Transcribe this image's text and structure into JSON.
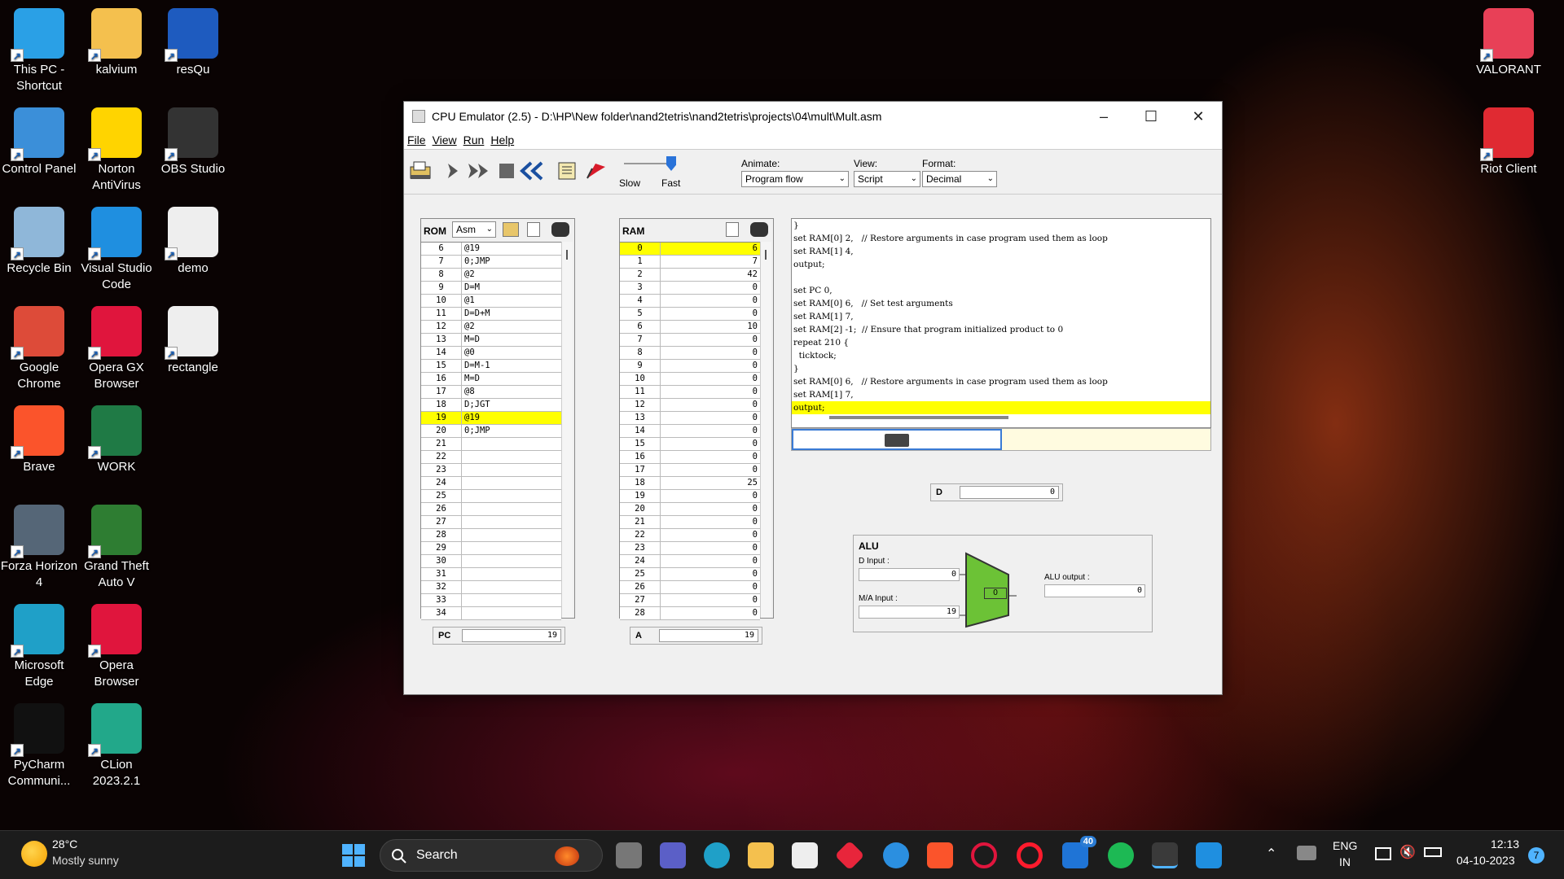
{
  "desktop_icons": [
    {
      "label": "This PC - Shortcut",
      "icon": "monitor-icon",
      "color": "#2aa0e6"
    },
    {
      "label": "kalvium",
      "icon": "folder-icon",
      "color": "#f4c04e"
    },
    {
      "label": "resQu",
      "icon": "word-doc-icon",
      "color": "#1e5bbf"
    },
    {
      "label": "Control Panel",
      "icon": "control-panel-icon",
      "color": "#3b8fd9"
    },
    {
      "label": "Norton AntiVirus",
      "icon": "norton-icon",
      "color": "#ffd400"
    },
    {
      "label": "OBS Studio",
      "icon": "obs-icon",
      "color": "#333333"
    },
    {
      "label": "Recycle Bin",
      "icon": "recycle-bin-icon",
      "color": "#8fb7d9"
    },
    {
      "label": "Visual Studio Code",
      "icon": "vscode-icon",
      "color": "#1f8fe0"
    },
    {
      "label": "demo",
      "icon": "file-icon",
      "color": "#eeeeee"
    },
    {
      "label": "Google Chrome",
      "icon": "chrome-icon",
      "color": "#dd4b39"
    },
    {
      "label": "Opera GX Browser",
      "icon": "opera-gx-icon",
      "color": "#e0153d"
    },
    {
      "label": "rectangle",
      "icon": "file-icon",
      "color": "#eeeeee"
    },
    {
      "label": "Brave",
      "icon": "brave-icon",
      "color": "#fb542b"
    },
    {
      "label": "WORK",
      "icon": "excel-icon",
      "color": "#1f7a45"
    },
    {
      "label": "Forza Horizon 4",
      "icon": "forza-icon",
      "color": "#556677"
    },
    {
      "label": "Grand Theft Auto V",
      "icon": "gta-icon",
      "color": "#2e7d32"
    },
    {
      "label": "Microsoft Edge",
      "icon": "edge-icon",
      "color": "#1fa0c8"
    },
    {
      "label": "Opera Browser",
      "icon": "opera-icon",
      "color": "#e0153d"
    },
    {
      "label": "PyCharm Communi...",
      "icon": "pycharm-icon",
      "color": "#111111"
    },
    {
      "label": "CLion 2023.2.1",
      "icon": "clion-icon",
      "color": "#22a88a"
    }
  ],
  "right_icons": [
    {
      "label": "VALORANT",
      "icon": "valorant-icon",
      "color": "#e84057"
    },
    {
      "label": "Riot Client",
      "icon": "riot-icon",
      "color": "#e02a32"
    }
  ],
  "window": {
    "title": "CPU Emulator (2.5) - D:\\HP\\New folder\\nand2tetris\\nand2tetris\\projects\\04\\mult\\Mult.asm",
    "menu": [
      "File",
      "View",
      "Run",
      "Help"
    ],
    "slow_label": "Slow",
    "fast_label": "Fast",
    "animate_label": "Animate:",
    "animate_value": "Program flow",
    "view_label": "View:",
    "view_value": "Script",
    "format_label": "Format:",
    "format_value": "Decimal"
  },
  "rom": {
    "title": "ROM",
    "format": "Asm",
    "rows": [
      {
        "addr": "6",
        "instr": "@19"
      },
      {
        "addr": "7",
        "instr": "0;JMP"
      },
      {
        "addr": "8",
        "instr": "@2"
      },
      {
        "addr": "9",
        "instr": "D=M"
      },
      {
        "addr": "10",
        "instr": "@1"
      },
      {
        "addr": "11",
        "instr": "D=D+M"
      },
      {
        "addr": "12",
        "instr": "@2"
      },
      {
        "addr": "13",
        "instr": "M=D"
      },
      {
        "addr": "14",
        "instr": "@0"
      },
      {
        "addr": "15",
        "instr": "D=M-1"
      },
      {
        "addr": "16",
        "instr": "M=D"
      },
      {
        "addr": "17",
        "instr": "@8"
      },
      {
        "addr": "18",
        "instr": "D;JGT"
      },
      {
        "addr": "19",
        "instr": "@19"
      },
      {
        "addr": "20",
        "instr": "0;JMP"
      },
      {
        "addr": "21",
        "instr": ""
      },
      {
        "addr": "22",
        "instr": ""
      },
      {
        "addr": "23",
        "instr": ""
      },
      {
        "addr": "24",
        "instr": ""
      },
      {
        "addr": "25",
        "instr": ""
      },
      {
        "addr": "26",
        "instr": ""
      },
      {
        "addr": "27",
        "instr": ""
      },
      {
        "addr": "28",
        "instr": ""
      },
      {
        "addr": "29",
        "instr": ""
      },
      {
        "addr": "30",
        "instr": ""
      },
      {
        "addr": "31",
        "instr": ""
      },
      {
        "addr": "32",
        "instr": ""
      },
      {
        "addr": "33",
        "instr": ""
      },
      {
        "addr": "34",
        "instr": ""
      }
    ],
    "highlight": "19"
  },
  "ram": {
    "title": "RAM",
    "rows": [
      {
        "addr": "0",
        "val": "6"
      },
      {
        "addr": "1",
        "val": "7"
      },
      {
        "addr": "2",
        "val": "42"
      },
      {
        "addr": "3",
        "val": "0"
      },
      {
        "addr": "4",
        "val": "0"
      },
      {
        "addr": "5",
        "val": "0"
      },
      {
        "addr": "6",
        "val": "10"
      },
      {
        "addr": "7",
        "val": "0"
      },
      {
        "addr": "8",
        "val": "0"
      },
      {
        "addr": "9",
        "val": "0"
      },
      {
        "addr": "10",
        "val": "0"
      },
      {
        "addr": "11",
        "val": "0"
      },
      {
        "addr": "12",
        "val": "0"
      },
      {
        "addr": "13",
        "val": "0"
      },
      {
        "addr": "14",
        "val": "0"
      },
      {
        "addr": "15",
        "val": "0"
      },
      {
        "addr": "16",
        "val": "0"
      },
      {
        "addr": "17",
        "val": "0"
      },
      {
        "addr": "18",
        "val": "25"
      },
      {
        "addr": "19",
        "val": "0"
      },
      {
        "addr": "20",
        "val": "0"
      },
      {
        "addr": "21",
        "val": "0"
      },
      {
        "addr": "22",
        "val": "0"
      },
      {
        "addr": "23",
        "val": "0"
      },
      {
        "addr": "24",
        "val": "0"
      },
      {
        "addr": "25",
        "val": "0"
      },
      {
        "addr": "26",
        "val": "0"
      },
      {
        "addr": "27",
        "val": "0"
      },
      {
        "addr": "28",
        "val": "0"
      }
    ],
    "highlight": "0"
  },
  "script_lines": [
    "}",
    "set RAM[0] 2,   // Restore arguments in case program used them as loop",
    "set RAM[1] 4,",
    "output;",
    "",
    "set PC 0,",
    "set RAM[0] 6,   // Set test arguments",
    "set RAM[1] 7,",
    "set RAM[2] -1;  // Ensure that program initialized product to 0",
    "repeat 210 {",
    "  ticktock;",
    "}",
    "set RAM[0] 6,   // Restore arguments in case program used them as loop",
    "set RAM[1] 7,",
    "output;"
  ],
  "script_highlight_index": 14,
  "registers": {
    "pc_label": "PC",
    "pc": "19",
    "a_label": "A",
    "a": "19",
    "d_label": "D",
    "d": "0"
  },
  "alu": {
    "title": "ALU",
    "d_input_label": "D Input :",
    "d_input": "0",
    "ma_input_label": "M/A Input :",
    "ma_input": "19",
    "output_label": "ALU output :",
    "output": "0",
    "center": "0"
  },
  "taskbar": {
    "weather_temp": "28°C",
    "weather_desc": "Mostly sunny",
    "search_placeholder": "Search",
    "lang1": "ENG",
    "lang2": "IN",
    "time": "12:13",
    "date": "04-10-2023",
    "notif_badge": "7",
    "store_badge": "40"
  }
}
